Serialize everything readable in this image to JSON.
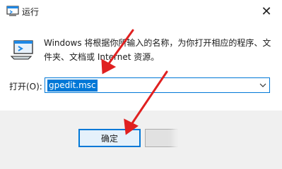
{
  "window": {
    "title": "运行",
    "close_glyph": "✕",
    "icon": "run-app-icon"
  },
  "dialog": {
    "description": "Windows 将根据你所输入的名称，为你打开相应的程序、文件夹、文档或 Internet 资源。",
    "open_label": "打开(O):",
    "open_value": "gpedit.msc"
  },
  "buttons": {
    "ok": "确定",
    "cancel": "",
    "browse": ""
  },
  "annotations": {
    "arrow_color": "#e02020"
  },
  "colors": {
    "accent": "#0078d7",
    "selection_bg": "#0078d7"
  }
}
